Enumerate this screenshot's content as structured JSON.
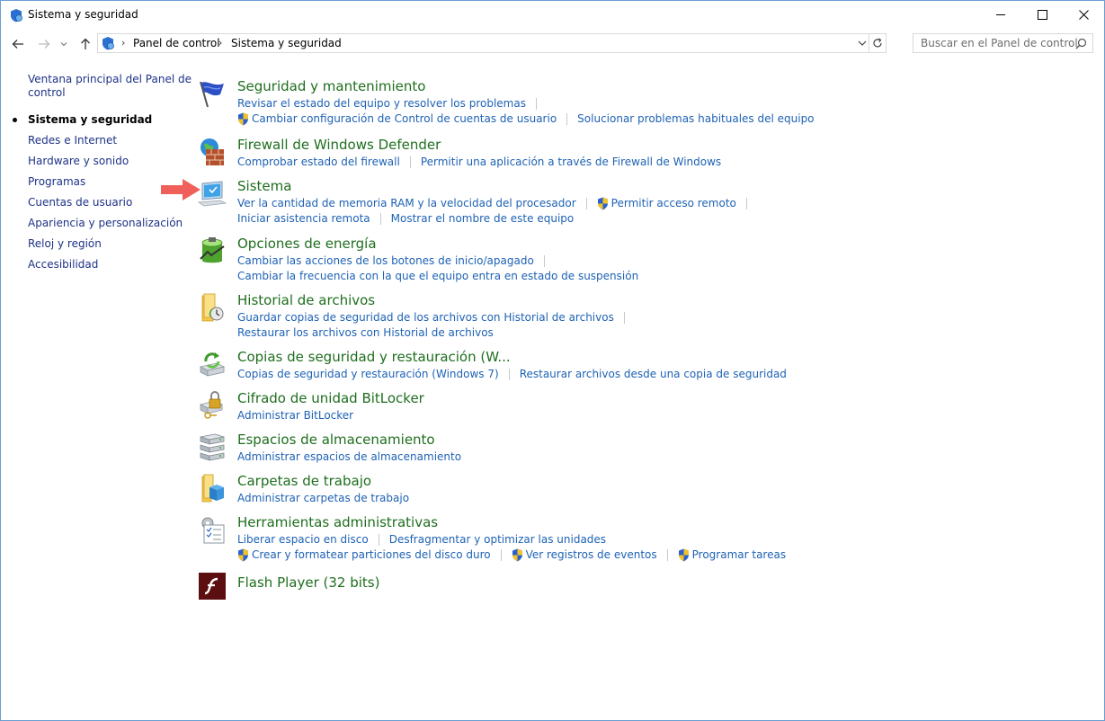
{
  "window": {
    "title": "Sistema y seguridad"
  },
  "nav": {
    "breadcrumb": [
      "Panel de control",
      "Sistema y seguridad"
    ],
    "search_placeholder": "Buscar en el Panel de control"
  },
  "sidebar": {
    "items": [
      {
        "label": "Ventana principal del Panel de control",
        "line1": "Ventana principal del Panel de",
        "line2": "control",
        "current": false
      },
      {
        "label": "Sistema y seguridad",
        "current": true
      },
      {
        "label": "Redes e Internet",
        "current": false
      },
      {
        "label": "Hardware y sonido",
        "current": false
      },
      {
        "label": "Programas",
        "current": false
      },
      {
        "label": "Cuentas de usuario",
        "current": false
      },
      {
        "label": "Apariencia y personalización",
        "current": false
      },
      {
        "label": "Reloj y región",
        "current": false
      },
      {
        "label": "Accesibilidad",
        "current": false
      }
    ]
  },
  "categories": [
    {
      "title": "Seguridad y mantenimiento",
      "icon": "flag-icon",
      "links": [
        [
          "Revisar el estado del equipo y resolver los problemas"
        ],
        [
          "Cambiar configuración de Control de cuentas de usuario",
          "Solucionar problemas habituales del equipo"
        ]
      ]
    },
    {
      "title": "Firewall de Windows Defender",
      "icon": "firewall-icon",
      "links": [
        [
          "Comprobar estado del firewall",
          "Permitir una aplicación a través de Firewall de Windows"
        ]
      ]
    },
    {
      "title": "Sistema",
      "icon": "computer-icon",
      "links": [
        [
          "Ver la cantidad de memoria RAM y la velocidad del procesador",
          "Permitir acceso remoto"
        ],
        [
          "Iniciar asistencia remota",
          "Mostrar el nombre de este equipo"
        ]
      ]
    },
    {
      "title": "Opciones de energía",
      "icon": "battery-icon",
      "links": [
        [
          "Cambiar las acciones de los botones de inicio/apagado"
        ],
        [
          "Cambiar la frecuencia con la que el equipo entra en estado de suspensión"
        ]
      ]
    },
    {
      "title": "Historial de archivos",
      "icon": "file-history-icon",
      "links": [
        [
          "Guardar copias de seguridad de los archivos con Historial de archivos"
        ],
        [
          "Restaurar los archivos con Historial de archivos"
        ]
      ]
    },
    {
      "title": "Copias de seguridad y restauración (W...",
      "icon": "backup-icon",
      "links": [
        [
          "Copias de seguridad y restauración (Windows 7)",
          "Restaurar archivos desde una copia de seguridad"
        ]
      ]
    },
    {
      "title": "Cifrado de unidad BitLocker",
      "icon": "bitlocker-icon",
      "links": [
        [
          "Administrar BitLocker"
        ]
      ]
    },
    {
      "title": "Espacios de almacenamiento",
      "icon": "storage-icon",
      "links": [
        [
          "Administrar espacios de almacenamiento"
        ]
      ]
    },
    {
      "title": "Carpetas de trabajo",
      "icon": "work-folders-icon",
      "links": [
        [
          "Administrar carpetas de trabajo"
        ]
      ]
    },
    {
      "title": "Herramientas administrativas",
      "icon": "admin-tools-icon",
      "links": [
        [
          "Liberar espacio en disco",
          "Desfragmentar y optimizar las unidades"
        ],
        [
          "Crear y formatear particiones del disco duro",
          "Ver registros de eventos",
          "Programar tareas"
        ]
      ]
    },
    {
      "title": "Flash Player (32 bits)",
      "icon": "flash-icon",
      "links": []
    }
  ],
  "colors": {
    "title_green": "#1e6e1e",
    "link_blue": "#1e62b4",
    "pointer_arrow": "#f0605a"
  }
}
